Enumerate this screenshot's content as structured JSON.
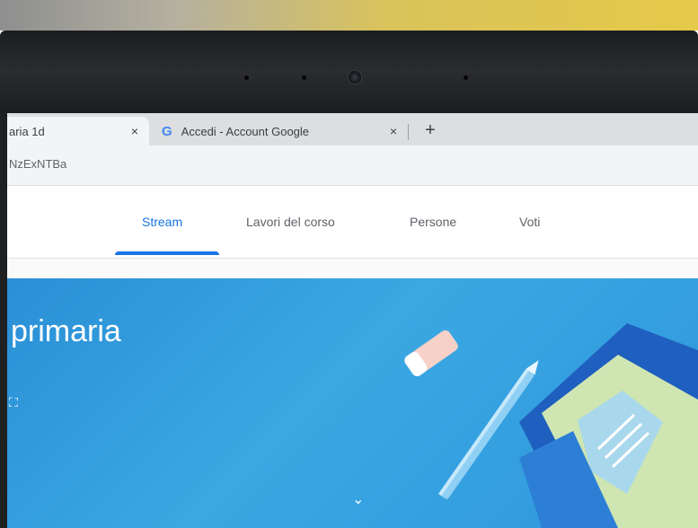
{
  "browser": {
    "tabs": [
      {
        "label": "aria 1d",
        "close": "×",
        "active": true
      },
      {
        "label": "Accedi - Account Google",
        "close": "×",
        "favicon": "G",
        "active": false
      }
    ],
    "new_tab": "+",
    "url": "NzExNTBa"
  },
  "classroom": {
    "nav": [
      {
        "label": "Stream",
        "active": true
      },
      {
        "label": "Lavori del corso",
        "active": false
      },
      {
        "label": "Persone",
        "active": false
      },
      {
        "label": "Voti",
        "active": false
      }
    ],
    "banner": {
      "title": "primaria",
      "expand_icon": "⛶",
      "chevron": "⌄"
    }
  },
  "colors": {
    "accent": "#1a73e8",
    "banner": "#2f96dc",
    "tabbar": "#dcdedf"
  }
}
